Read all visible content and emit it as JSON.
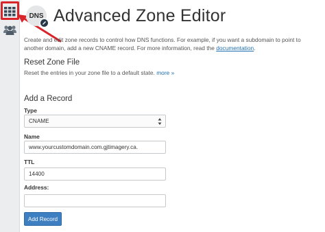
{
  "header": {
    "icon_text": "DNS",
    "title": "Advanced Zone Editor"
  },
  "description": {
    "text": "Create and edit zone records to control how DNS functions. For example, if you want a subdomain to point to another domain, add a new CNAME record. For more information, read the ",
    "link": "documentation",
    "end": "."
  },
  "reset": {
    "heading": "Reset Zone File",
    "text": "Reset the entries in your zone file to a default state.",
    "more_link": "more »"
  },
  "add_record": {
    "heading": "Add a Record",
    "type_label": "Type",
    "type_value": "CNAME",
    "name_label": "Name",
    "name_value": "www.yourcustomdomain.com.gjtimagery.ca.",
    "ttl_label": "TTL",
    "ttl_value": "14400",
    "address_label": "Address:",
    "address_value": "",
    "submit_label": "Add Record"
  },
  "sidebar": {
    "items": [
      {
        "icon": "grid-icon",
        "highlighted": true
      },
      {
        "icon": "users-icon",
        "highlighted": false
      }
    ]
  },
  "colors": {
    "annotation": "#d9242a",
    "button": "#3d7fc1",
    "link": "#1f6fb2"
  }
}
